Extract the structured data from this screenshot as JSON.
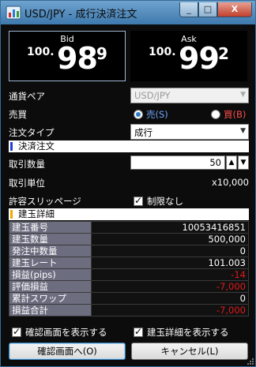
{
  "window": {
    "title": "USD/JPY - 成行決済注文",
    "min": "_",
    "max": "□",
    "close": "X"
  },
  "quotes": {
    "bid": {
      "label": "Bid",
      "prefix": "100.",
      "big": "98",
      "pip": "9"
    },
    "ask": {
      "label": "Ask",
      "prefix": "100.",
      "big": "99",
      "pip": "2"
    }
  },
  "form": {
    "pair_label": "通貨ペア",
    "pair_value": "USD/JPY",
    "side_label": "売買",
    "sell_label": "売(S)",
    "buy_label": "買(B)",
    "order_type_label": "注文タイプ",
    "order_type_value": "成行"
  },
  "section_close": "決済注文",
  "qty": {
    "label": "取引数量",
    "value": "50",
    "up": "▲",
    "down": "▼"
  },
  "unit": {
    "label": "取引単位",
    "value": "x10,000"
  },
  "slippage": {
    "label": "許容スリッページ",
    "checkbox_label": "制限なし"
  },
  "section_detail": "建玉詳細",
  "details": [
    {
      "key": "建玉番号",
      "value": "10053416851",
      "negative": false
    },
    {
      "key": "建玉数量",
      "value": "500,000",
      "negative": false
    },
    {
      "key": "発注中数量",
      "value": "0",
      "negative": false
    },
    {
      "key": "建玉レート",
      "value": "101.003",
      "negative": false
    },
    {
      "key": "損益(pips)",
      "value": "-14",
      "negative": true
    },
    {
      "key": "評価損益",
      "value": "-7,000",
      "negative": true
    },
    {
      "key": "累計スワップ",
      "value": "0",
      "negative": false
    },
    {
      "key": "損益合計",
      "value": "-7,000",
      "negative": true
    }
  ],
  "checkboxes": {
    "confirm_screen": "確認画面を表示する",
    "show_detail": "建玉詳細を表示する"
  },
  "buttons": {
    "confirm": "確認画面へ(O)",
    "cancel": "キャンセル(L)"
  },
  "colors": {
    "section_bar_close": "#1f3fd6",
    "section_bar_detail": "#f2a800",
    "negative": "#e01919"
  }
}
